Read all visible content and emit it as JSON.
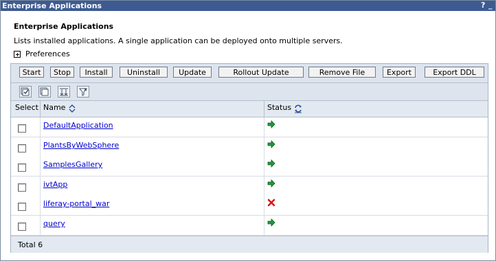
{
  "window": {
    "title": "Enterprise Applications",
    "help_glyph": "?",
    "minimize_glyph": "_"
  },
  "page": {
    "heading": "Enterprise Applications",
    "description": "Lists installed applications. A single application can be deployed onto multiple servers.",
    "preferences_label": "Preferences"
  },
  "toolbar": {
    "buttons": [
      "Start",
      "Stop",
      "Install",
      "Uninstall",
      "Update",
      "Rollout Update",
      "Remove File",
      "Export",
      "Export DDL"
    ]
  },
  "icon_toolbar": {
    "icons": [
      "select-all-icon",
      "deselect-all-icon",
      "show-filter-icon",
      "clear-filter-icon"
    ]
  },
  "table": {
    "columns": {
      "select": "Select",
      "name": "Name",
      "status": "Status"
    },
    "sort_icon": "sort-icon",
    "refresh_icon": "refresh-icon",
    "rows": [
      {
        "name": "DefaultApplication",
        "status": "started"
      },
      {
        "name": "PlantsByWebSphere",
        "status": "started"
      },
      {
        "name": "SamplesGallery",
        "status": "started"
      },
      {
        "name": "ivtApp",
        "status": "started"
      },
      {
        "name": "liferay-portal_war",
        "status": "stopped"
      },
      {
        "name": "query",
        "status": "started"
      }
    ],
    "total": "Total 6"
  },
  "colors": {
    "titlebar": "#3e5b91",
    "started": "#1f9a3a",
    "stopped": "#d61818",
    "link": "#0000cc"
  }
}
